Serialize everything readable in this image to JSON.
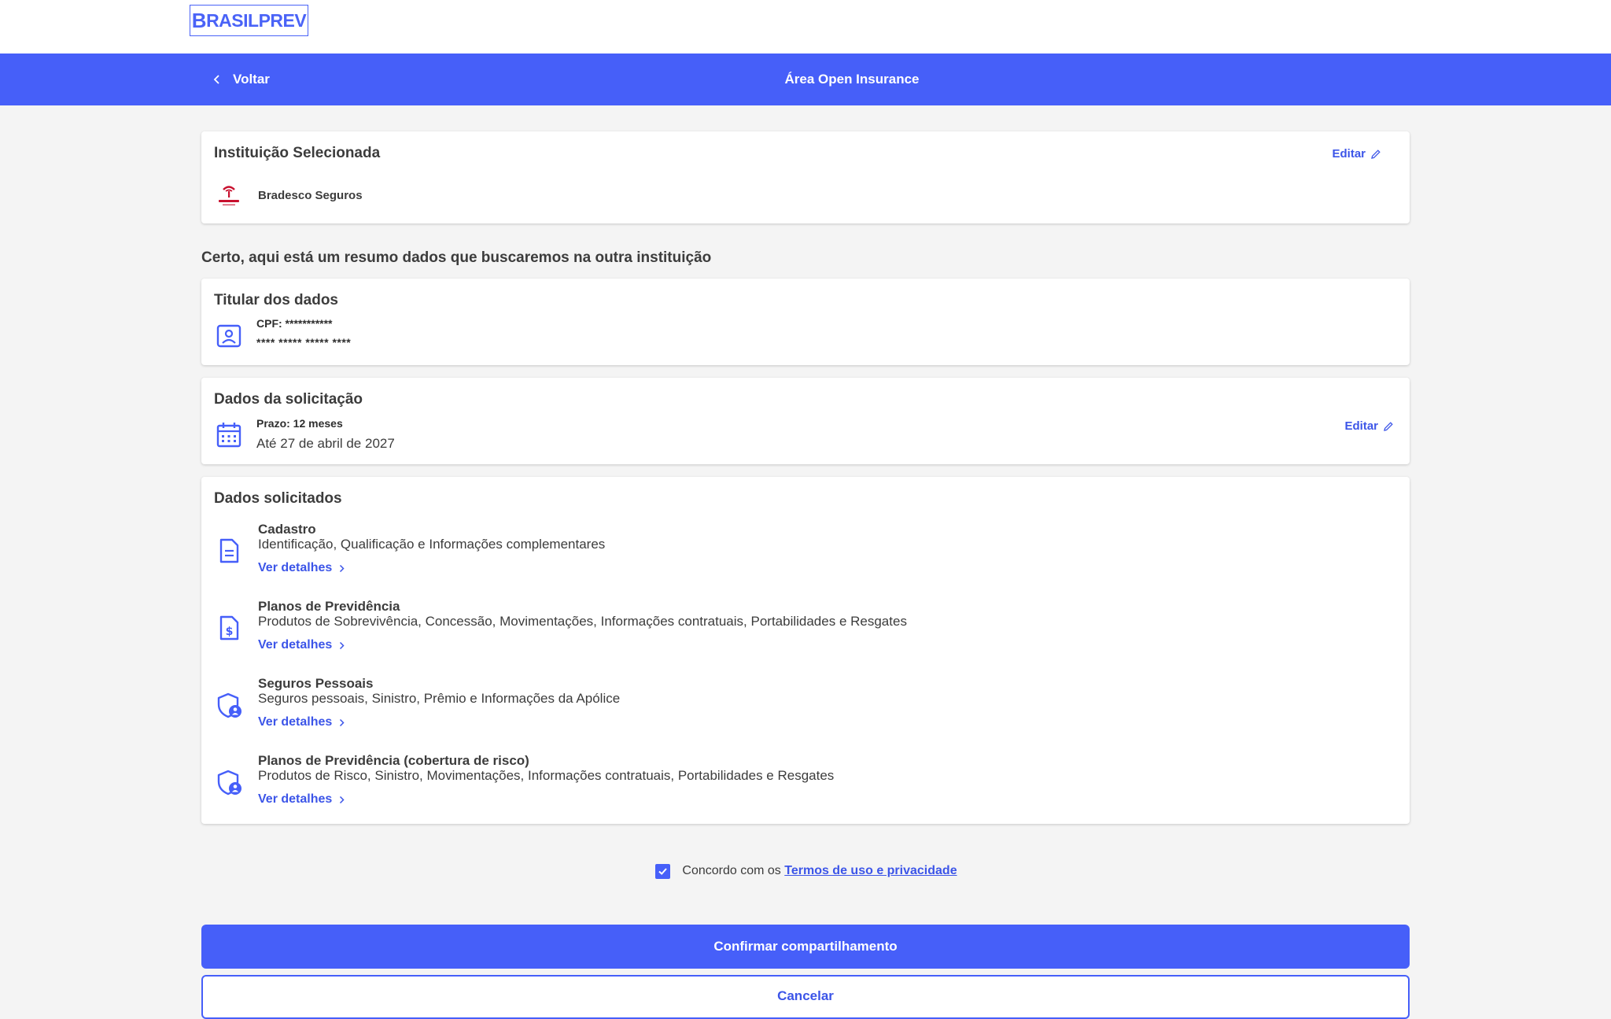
{
  "header": {
    "logo_first": "B",
    "logo_rest": "RASILPREV"
  },
  "navbar": {
    "back_label": "Voltar",
    "title": "Área Open Insurance"
  },
  "institution_card": {
    "title": "Instituição Selecionada",
    "edit_label": "Editar",
    "institution_name": "Bradesco Seguros"
  },
  "summary_heading": "Certo, aqui está um resumo dados que buscaremos na outra instituição",
  "holder_card": {
    "title": "Titular dos dados",
    "cpf": "CPF: ***********",
    "name_masked": "**** ***** ***** ****"
  },
  "request_card": {
    "title": "Dados da solicitação",
    "term": "Prazo: 12 meses",
    "until": "Até 27 de abril de 2027",
    "edit_label": "Editar"
  },
  "requested_card": {
    "title": "Dados solicitados",
    "items": [
      {
        "title": "Cadastro",
        "description": "Identificação, Qualificação e Informações complementares",
        "link": "Ver detalhes",
        "icon": "document-icon"
      },
      {
        "title": "Planos de Previdência",
        "description": "Produtos de Sobrevivência, Concessão, Movimentações, Informações contratuais, Portabilidades e Resgates",
        "link": "Ver detalhes",
        "icon": "dollar-document-icon"
      },
      {
        "title": "Seguros Pessoais",
        "description": "Seguros pessoais, Sinistro, Prêmio e Informações da Apólice",
        "link": "Ver detalhes",
        "icon": "shield-user-icon"
      },
      {
        "title": "Planos de Previdência (cobertura de risco)",
        "description": "Produtos de Risco, Sinistro, Movimentações, Informações contratuais, Portabilidades e Resgates",
        "link": "Ver detalhes",
        "icon": "shield-user-icon"
      }
    ]
  },
  "agreement": {
    "checked": true,
    "text": "Concordo com os",
    "link": "Termos de uso e privacidade"
  },
  "buttons": {
    "confirm": "Confirmar compartilhamento",
    "cancel": "Cancelar"
  },
  "colors": {
    "primary": "#465ff9",
    "link": "#3c55e8",
    "background": "#f4f4f4",
    "text": "#3c3c3c"
  }
}
